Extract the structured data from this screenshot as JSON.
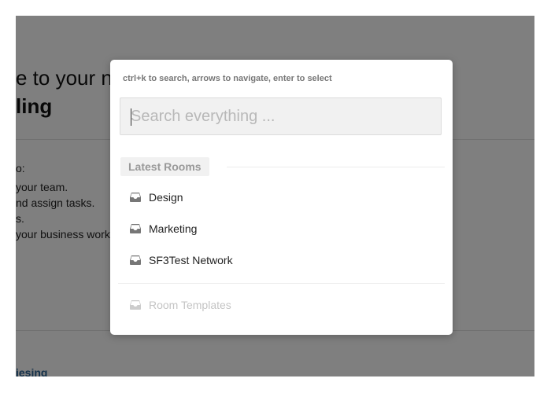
{
  "background_page": {
    "welcome_title": "e to your n",
    "welcome_name": "ling",
    "intro_lead": "o:",
    "intro_items": [
      "your team.",
      "nd assign tasks.",
      "s.",
      "your business work"
    ],
    "footer_link": "iesing"
  },
  "search_modal": {
    "hint": "ctrl+k to search, arrows to navigate, enter to select",
    "search": {
      "placeholder": "Search everything ...",
      "value": ""
    },
    "section_title": "Latest Rooms",
    "rooms": [
      {
        "label": "Design",
        "icon": "inbox-icon"
      },
      {
        "label": "Marketing",
        "icon": "inbox-icon"
      },
      {
        "label": "SF3Test Network",
        "icon": "inbox-icon"
      }
    ],
    "templates_item": {
      "label": "Room Templates",
      "icon": "inbox-icon"
    }
  },
  "colors": {
    "overlay": "rgba(0,0,0,0.5)",
    "link": "#2a6496",
    "icon": "#777777",
    "icon_disabled": "#cccccc"
  }
}
